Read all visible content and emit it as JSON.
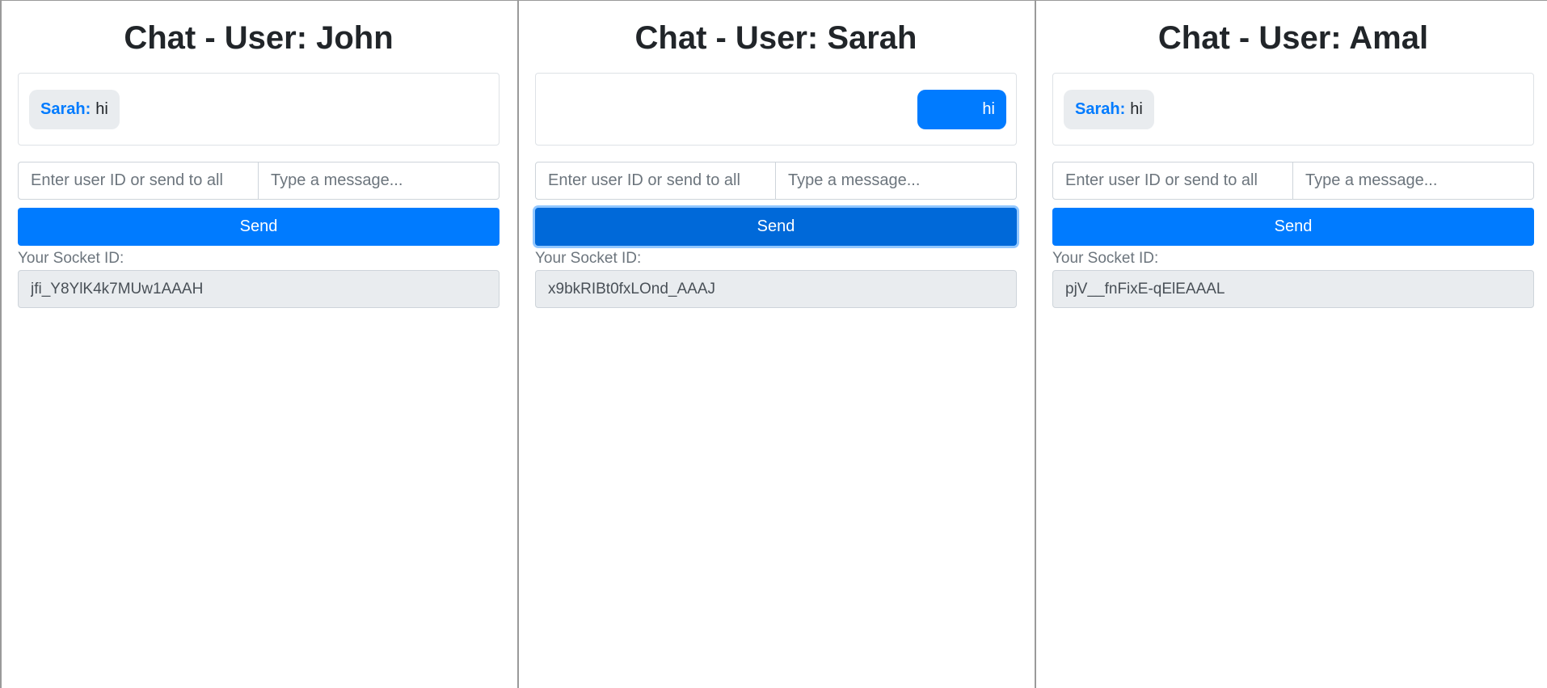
{
  "panels": [
    {
      "title": "Chat - User: John",
      "message": {
        "direction": "received",
        "sender": "Sarah:",
        "text": "hi"
      },
      "recipient_placeholder": "Enter user ID or send to all",
      "message_placeholder": "Type a message...",
      "send_label": "Send",
      "socket_label": "Your Socket ID:",
      "socket_id": "jfi_Y8YlK4k7MUw1AAAH"
    },
    {
      "title": "Chat - User: Sarah",
      "message": {
        "direction": "sent",
        "text": "hi"
      },
      "recipient_placeholder": "Enter user ID or send to all",
      "message_placeholder": "Type a message...",
      "send_label": "Send",
      "socket_label": "Your Socket ID:",
      "socket_id": "x9bkRIBt0fxLOnd_AAAJ"
    },
    {
      "title": "Chat - User: Amal",
      "message": {
        "direction": "received",
        "sender": "Sarah:",
        "text": "hi"
      },
      "recipient_placeholder": "Enter user ID or send to all",
      "message_placeholder": "Type a message...",
      "send_label": "Send",
      "socket_label": "Your Socket ID:",
      "socket_id": "pjV__fnFixE-qElEAAAL"
    }
  ],
  "colors": {
    "primary": "#007bff",
    "primary_focused": "#0069d9",
    "received_bubble": "#e9ecef",
    "readonly_field": "#e9ecef"
  }
}
